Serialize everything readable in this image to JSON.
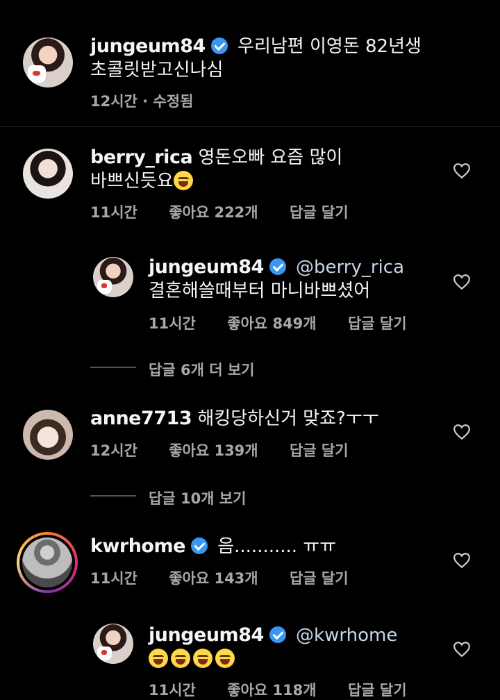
{
  "caption": {
    "username": "jungeum84",
    "text_line1": "우리남편 이영돈 82년생",
    "text_line2": "초콜릿받고신나심",
    "time": "12시간 · 수정됨"
  },
  "comments": [
    {
      "username": "berry_rica",
      "text_line1": "영돈오빠 요즘 많이",
      "text_line2": "바쁘신듯요",
      "emoji": "rolling-laughing",
      "time": "11시간",
      "likes": "좋아요 222개",
      "reply": "답글 달기"
    },
    {
      "username": "jungeum84",
      "mention": "@berry_rica",
      "text_line2": "결혼해쓸때부터 마니바쁘셨어",
      "time": "11시간",
      "likes": "좋아요 849개",
      "reply": "답글 달기"
    },
    {
      "view_replies": "답글 6개 더 보기"
    },
    {
      "username": "anne7713",
      "text_line1": "해킹당하신거 맞죠?ㅜㅜ",
      "time": "12시간",
      "likes": "좋아요 139개",
      "reply": "답글 달기"
    },
    {
      "view_replies": "답글 10개 보기"
    },
    {
      "username": "kwrhome",
      "text_line1": "음........... ㅠㅠ",
      "time": "11시간",
      "likes": "좋아요 143개",
      "reply": "답글 달기"
    },
    {
      "username": "jungeum84",
      "mention": "@kwrhome",
      "emojis": [
        "grinning-sweat",
        "grinning-sweat",
        "grinning-sweat",
        "grinning-sweat"
      ],
      "time": "11시간",
      "likes": "좋아요 118개",
      "reply": "답글 달기"
    }
  ],
  "colors": {
    "background": "#000000",
    "text": "#f5f5f5",
    "muted": "#a8a8a8",
    "verified": "#3897f0"
  }
}
